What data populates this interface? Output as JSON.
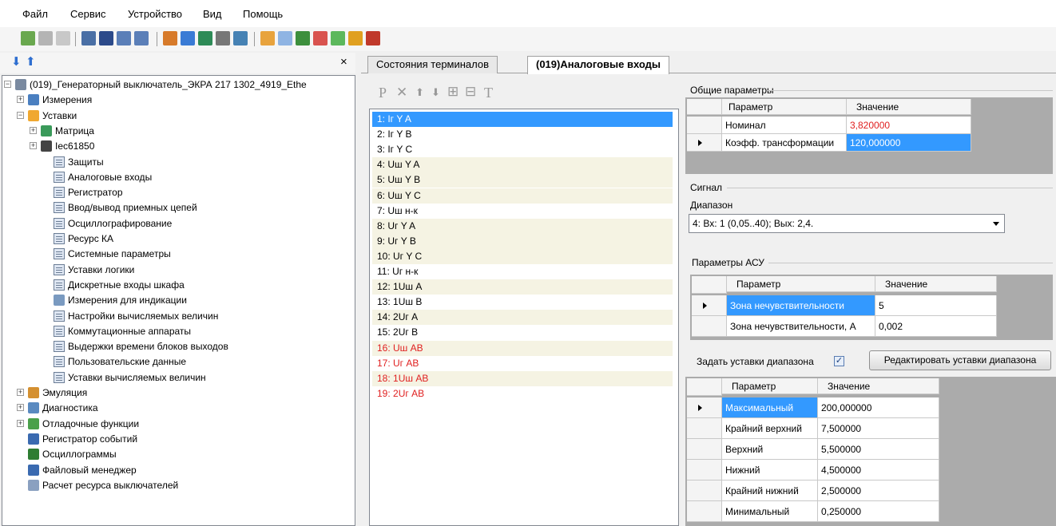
{
  "menu": [
    "Файл",
    "Сервис",
    "Устройство",
    "Вид",
    "Помощь"
  ],
  "left_panel": {
    "close_glyph": "×"
  },
  "tree": [
    {
      "label": "(019)_Генераторный выключатель_ЭКРА 217 1302_4919_Ethe",
      "icon": "device-icon",
      "expander": "−"
    },
    {
      "label": "Измерения",
      "icon": "measurements-icon",
      "expander": "+"
    },
    {
      "label": "Уставки",
      "icon": "settings-folder-icon",
      "expander": "−"
    },
    {
      "label": "Матрица",
      "icon": "matrix-icon",
      "expander": "+"
    },
    {
      "label": "Iec61850",
      "icon": "iec-icon",
      "expander": "+"
    },
    {
      "label": "Защиты",
      "icon": "grid-icon"
    },
    {
      "label": "Аналоговые входы",
      "icon": "grid-icon"
    },
    {
      "label": "Регистратор",
      "icon": "grid-icon"
    },
    {
      "label": "Ввод/вывод приемных цепей",
      "icon": "grid-icon"
    },
    {
      "label": "Осциллографирование",
      "icon": "grid-icon"
    },
    {
      "label": "Ресурс КА",
      "icon": "grid-icon"
    },
    {
      "label": "Системные параметры",
      "icon": "grid-icon"
    },
    {
      "label": "Уставки логики",
      "icon": "grid-icon"
    },
    {
      "label": "Дискретные входы шкафа",
      "icon": "grid-icon"
    },
    {
      "label": "Измерения для индикации",
      "icon": "gauge-icon"
    },
    {
      "label": "Настройки вычисляемых величин",
      "icon": "grid-icon"
    },
    {
      "label": "Коммутационные аппараты",
      "icon": "grid-icon"
    },
    {
      "label": "Выдержки времени блоков выходов",
      "icon": "grid-icon"
    },
    {
      "label": "Пользовательские данные",
      "icon": "grid-icon"
    },
    {
      "label": "Уставки вычисляемых величин",
      "icon": "grid-icon"
    },
    {
      "label": "Эмуляция",
      "icon": "emulation-icon",
      "expander": "+"
    },
    {
      "label": "Диагностика",
      "icon": "diagnostics-icon",
      "expander": "+"
    },
    {
      "label": "Отладочные функции",
      "icon": "debug-icon",
      "expander": "+"
    },
    {
      "label": "Регистратор событий",
      "icon": "event-log-icon"
    },
    {
      "label": "Осциллограммы",
      "icon": "oscillogram-icon"
    },
    {
      "label": "Файловый менеджер",
      "icon": "file-manager-icon"
    },
    {
      "label": "Расчет ресурса выключателей",
      "icon": "calc-icon"
    }
  ],
  "tabs": [
    "Состояния терминалов",
    "(019)Аналоговые входы"
  ],
  "list_toolbar": [
    "P",
    "✕",
    "⬆",
    "⬇",
    "⊞",
    "⊟",
    "T"
  ],
  "signals": [
    {
      "text": "1:  Iг Y A",
      "state": "sel"
    },
    {
      "text": "2:  Iг Y B",
      "state": "normal"
    },
    {
      "text": "3:  Iг Y C",
      "state": "normal"
    },
    {
      "text": "4:  Uш Y A",
      "state": "alt"
    },
    {
      "text": "5:  Uш Y B",
      "state": "alt"
    },
    {
      "text": "6:  Uш Y C",
      "state": "alt"
    },
    {
      "text": "7:  Uш н-к",
      "state": "normal"
    },
    {
      "text": "8:  Uг Y A",
      "state": "alt"
    },
    {
      "text": "9:  Uг Y B",
      "state": "alt"
    },
    {
      "text": "10:  Uг Y C",
      "state": "alt"
    },
    {
      "text": "11:  Uг н-к",
      "state": "normal"
    },
    {
      "text": "12:  1Uш A",
      "state": "alt"
    },
    {
      "text": "13:  1Uш B",
      "state": "normal"
    },
    {
      "text": "14:  2Uг A",
      "state": "alt"
    },
    {
      "text": "15:  2Uг B",
      "state": "normal"
    },
    {
      "text": "16:  Uш AB",
      "state": "alt red"
    },
    {
      "text": "17:  Uг AB",
      "state": "red"
    },
    {
      "text": "18:  1Uш AB",
      "state": "alt red"
    },
    {
      "text": "19:  2Uг AB",
      "state": "red"
    }
  ],
  "general": {
    "title": "Общие параметры",
    "col_param": "Параметр",
    "col_value": "Значение",
    "rows": [
      {
        "param": "Номинал",
        "value": "3,820000"
      },
      {
        "param": "Коэфф. трансформации",
        "value": "120,000000"
      }
    ]
  },
  "signal_group": {
    "title": "Сигнал",
    "range_label": "Диапазон",
    "range_value": "4: Вх: 1 (0,05..40); Вых: 2,4."
  },
  "asu": {
    "title": "Параметры АСУ",
    "col_param": "Параметр",
    "col_value": "Значение",
    "rows": [
      {
        "param": "Зона нечувствительности",
        "value": "5"
      },
      {
        "param": "Зона нечувствительности, А",
        "value": "0,002"
      }
    ]
  },
  "range_settings": {
    "label": "Задать уставки диапазона",
    "checked_glyph": "✓",
    "button": "Редактировать уставки диапазона",
    "col_param": "Параметр",
    "col_value": "Значение",
    "rows": [
      {
        "param": "Максимальный",
        "value": "200,000000"
      },
      {
        "param": "Крайний верхний",
        "value": "7,500000"
      },
      {
        "param": "Верхний",
        "value": "5,500000"
      },
      {
        "param": "Нижний",
        "value": "4,500000"
      },
      {
        "param": "Крайний нижний",
        "value": "2,500000"
      },
      {
        "param": "Минимальный",
        "value": "0,250000"
      }
    ]
  },
  "colors": {
    "selection": "#3399ff",
    "alert_red": "#e02020",
    "alt_row": "#f5f3e3"
  }
}
